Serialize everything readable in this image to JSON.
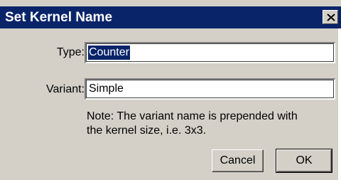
{
  "window": {
    "title": "Set Kernel Name",
    "close_icon": "close-icon"
  },
  "form": {
    "type_label": "Type:",
    "type_value": "Counter",
    "variant_label": "Variant:",
    "variant_value": "Simple"
  },
  "note": {
    "line1": "Note: The variant name is prepended with",
    "line2": "the kernel size, i.e. 3x3."
  },
  "buttons": {
    "cancel": "Cancel",
    "ok": "OK"
  },
  "colors": {
    "titlebar": "#0a246a",
    "dialog_face": "#d4d0c8",
    "selection": "#0a246a"
  }
}
